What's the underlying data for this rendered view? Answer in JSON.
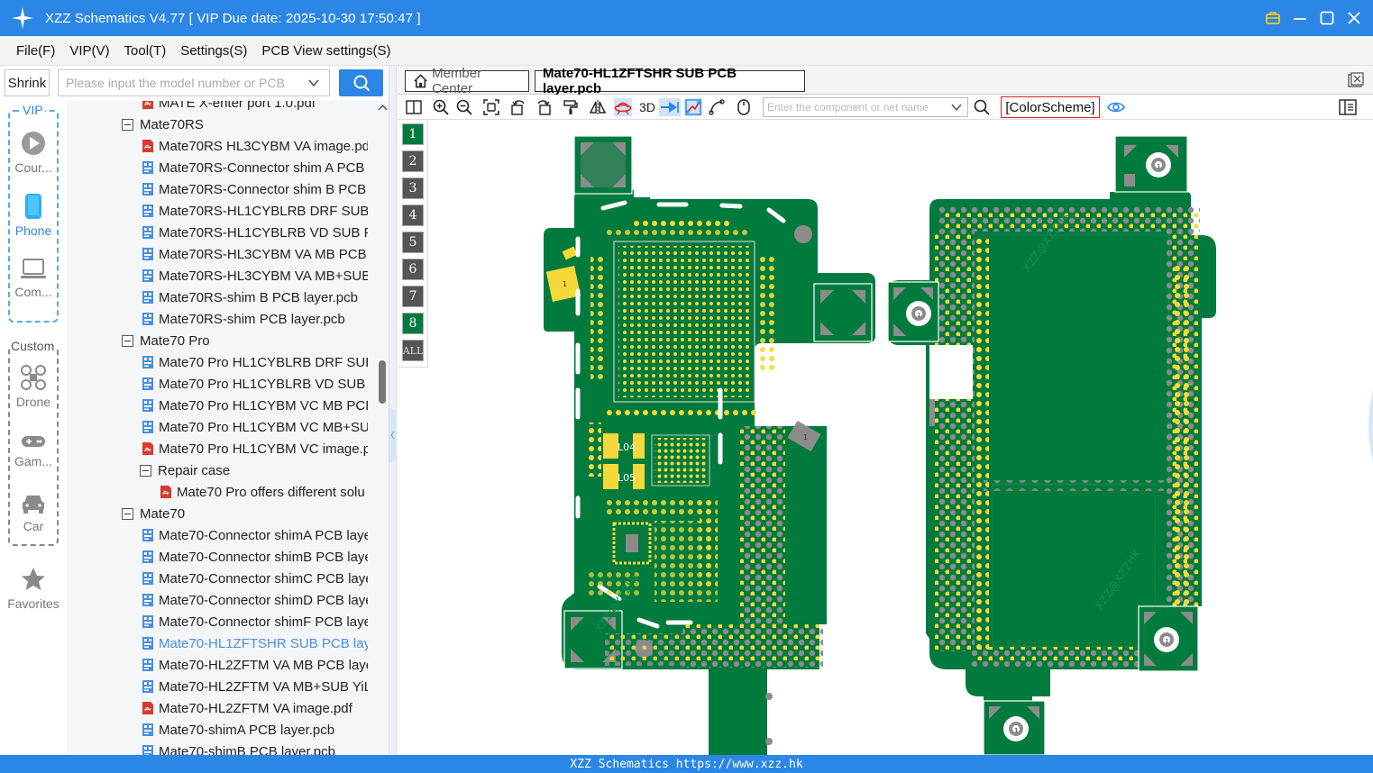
{
  "app": {
    "title": "XZZ Schematics V4.77 [ VIP Due date: 2025-10-30 17:50:47 ]"
  },
  "menu": [
    {
      "label": "File(F)"
    },
    {
      "label": "VIP(V)"
    },
    {
      "label": "Tool(T)"
    },
    {
      "label": "Settings(S)"
    },
    {
      "label": "PCB View settings(S)"
    }
  ],
  "search": {
    "shrink_label": "Shrink",
    "placeholder": "Please input the model number or PCB"
  },
  "sidebar": {
    "vip_label": "VIP",
    "custom_label": "Custom",
    "items": [
      {
        "label": "Cour..."
      },
      {
        "label": "Phone"
      },
      {
        "label": "Com..."
      },
      {
        "label": "Drone"
      },
      {
        "label": "Gam..."
      },
      {
        "label": "Car"
      },
      {
        "label": "Favorites"
      }
    ]
  },
  "tree": [
    {
      "label": "MATE X-enter port 1.0.pdf",
      "kind": "pdf",
      "level": 2
    },
    {
      "label": "Mate70RS",
      "kind": "folder",
      "level": 1
    },
    {
      "label": "Mate70RS HL3CYBM VA image.pdf",
      "kind": "pdf",
      "level": 2
    },
    {
      "label": "Mate70RS-Connector shim A PCB l",
      "kind": "pcb",
      "level": 2
    },
    {
      "label": "Mate70RS-Connector shim B PCB l",
      "kind": "pcb",
      "level": 2
    },
    {
      "label": "Mate70RS-HL1CYBLRB DRF SUB PC",
      "kind": "pcb",
      "level": 2
    },
    {
      "label": "Mate70RS-HL1CYBLRB VD SUB PCI",
      "kind": "pcb",
      "level": 2
    },
    {
      "label": "Mate70RS-HL3CYBM VA MB PCB la",
      "kind": "pcb",
      "level": 2
    },
    {
      "label": "Mate70RS-HL3CYBM VA MB+SUB",
      "kind": "pcb",
      "level": 2
    },
    {
      "label": "Mate70RS-shim B PCB layer.pcb",
      "kind": "pcb",
      "level": 2
    },
    {
      "label": "Mate70RS-shim PCB layer.pcb",
      "kind": "pcb",
      "level": 2
    },
    {
      "label": "Mate70 Pro",
      "kind": "folder",
      "level": 1
    },
    {
      "label": "Mate70 Pro HL1CYBLRB DRF SUB F",
      "kind": "pcb",
      "level": 2
    },
    {
      "label": "Mate70 Pro HL1CYBLRB VD SUB P(",
      "kind": "pcb",
      "level": 2
    },
    {
      "label": "Mate70 Pro HL1CYBM VC MB PCB",
      "kind": "pcb",
      "level": 2
    },
    {
      "label": "Mate70 Pro HL1CYBM VC MB+SUE",
      "kind": "pcb",
      "level": 2
    },
    {
      "label": "Mate70 Pro HL1CYBM VC image.pc",
      "kind": "pdf",
      "level": 2
    },
    {
      "label": "Repair case",
      "kind": "folder",
      "level": 2
    },
    {
      "label": "Mate70 Pro offers different solu",
      "kind": "pdf",
      "level": 3
    },
    {
      "label": "Mate70",
      "kind": "folder",
      "level": 1
    },
    {
      "label": "Mate70-Connector shimA PCB laye",
      "kind": "pcb",
      "level": 2
    },
    {
      "label": "Mate70-Connector shimB PCB laye",
      "kind": "pcb",
      "level": 2
    },
    {
      "label": "Mate70-Connector shimC PCB laye",
      "kind": "pcb",
      "level": 2
    },
    {
      "label": "Mate70-Connector shimD PCB laye",
      "kind": "pcb",
      "level": 2
    },
    {
      "label": "Mate70-Connector shimF PCB laye",
      "kind": "pcb",
      "level": 2
    },
    {
      "label": "Mate70-HL1ZFTSHR SUB PCB layer",
      "kind": "pcb",
      "level": 2,
      "selected": true
    },
    {
      "label": "Mate70-HL2ZFTM VA MB PCB laye",
      "kind": "pcb",
      "level": 2
    },
    {
      "label": "Mate70-HL2ZFTM VA MB+SUB YiL",
      "kind": "pcb",
      "level": 2
    },
    {
      "label": "Mate70-HL2ZFTM VA image.pdf",
      "kind": "pdf",
      "level": 2
    },
    {
      "label": "Mate70-shimA PCB layer.pcb",
      "kind": "pcb",
      "level": 2
    },
    {
      "label": "Mate70-shimB PCB layer.pcb",
      "kind": "pcb",
      "level": 2
    }
  ],
  "tabs": {
    "member_center": "Member Center",
    "active_file": "Mate70-HL1ZFTSHR SUB PCB layer.pcb"
  },
  "toolbar": {
    "three_d_label": "3D",
    "net_search_placeholder": "Enter the component or net name",
    "color_scheme_label": "[ColorScheme]"
  },
  "layers": [
    {
      "label": "1",
      "active": true
    },
    {
      "label": "2",
      "active": false
    },
    {
      "label": "3",
      "active": false
    },
    {
      "label": "4",
      "active": false
    },
    {
      "label": "5",
      "active": false
    },
    {
      "label": "6",
      "active": false
    },
    {
      "label": "7",
      "active": false
    },
    {
      "label": "8",
      "active": true
    },
    {
      "label": "ALL",
      "active": false
    }
  ],
  "pcb": {
    "labels": {
      "pad_1": "1",
      "inductor_a": "L04",
      "inductor_b": "L05",
      "watermark": "XZZ@XZZHK"
    }
  },
  "status": {
    "text": "XZZ Schematics https://www.xzz.hk"
  },
  "colors": {
    "accent": "#2b86e5",
    "board_green": "#007a3d",
    "pad_yellow": "#f5d93a",
    "via_gray": "#8c8c8c",
    "highlight_red": "#e02020",
    "pdf_red": "#d83a2f",
    "pcb_blue": "#4a8fe0"
  }
}
